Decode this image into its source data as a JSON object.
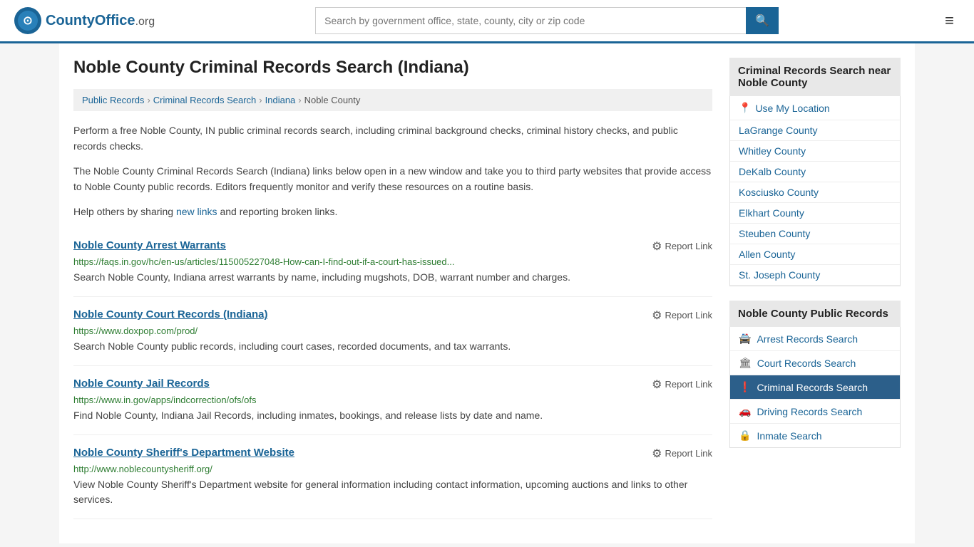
{
  "header": {
    "logo_text": "CountyOffice",
    "logo_ext": ".org",
    "search_placeholder": "Search by government office, state, county, city or zip code",
    "search_value": ""
  },
  "page": {
    "title": "Noble County Criminal Records Search (Indiana)",
    "breadcrumbs": [
      {
        "label": "Public Records",
        "href": "#"
      },
      {
        "label": "Criminal Records Search",
        "href": "#"
      },
      {
        "label": "Indiana",
        "href": "#"
      },
      {
        "label": "Noble County",
        "href": "#"
      }
    ],
    "description1": "Perform a free Noble County, IN public criminal records search, including criminal background checks, criminal history checks, and public records checks.",
    "description2": "The Noble County Criminal Records Search (Indiana) links below open in a new window and take you to third party websites that provide access to Noble County public records. Editors frequently monitor and verify these resources on a routine basis.",
    "description3_prefix": "Help others by sharing ",
    "new_links_label": "new links",
    "description3_suffix": " and reporting broken links.",
    "records": [
      {
        "title": "Noble County Arrest Warrants",
        "url": "https://faqs.in.gov/hc/en-us/articles/115005227048-How-can-I-find-out-if-a-court-has-issued...",
        "description": "Search Noble County, Indiana arrest warrants by name, including mugshots, DOB, warrant number and charges.",
        "report_label": "Report Link"
      },
      {
        "title": "Noble County Court Records (Indiana)",
        "url": "https://www.doxpop.com/prod/",
        "description": "Search Noble County public records, including court cases, recorded documents, and tax warrants.",
        "report_label": "Report Link"
      },
      {
        "title": "Noble County Jail Records",
        "url": "https://www.in.gov/apps/indcorrection/ofs/ofs",
        "description": "Find Noble County, Indiana Jail Records, including inmates, bookings, and release lists by date and name.",
        "report_label": "Report Link"
      },
      {
        "title": "Noble County Sheriff's Department Website",
        "url": "http://www.noblecountysheriff.org/",
        "description": "View Noble County Sheriff's Department website for general information including contact information, upcoming auctions and links to other services.",
        "report_label": "Report Link"
      }
    ]
  },
  "sidebar": {
    "nearby_title": "Criminal Records Search near Noble County",
    "use_location_label": "Use My Location",
    "nearby_counties": [
      "LaGrange County",
      "Whitley County",
      "DeKalb County",
      "Kosciusko County",
      "Elkhart County",
      "Steuben County",
      "Allen County",
      "St. Joseph County"
    ],
    "public_records_title": "Noble County Public Records",
    "public_records_items": [
      {
        "label": "Arrest Records Search",
        "icon": "🚔",
        "active": false
      },
      {
        "label": "Court Records Search",
        "icon": "🏛",
        "active": false
      },
      {
        "label": "Criminal Records Search",
        "icon": "❗",
        "active": true
      },
      {
        "label": "Driving Records Search",
        "icon": "🚗",
        "active": false
      },
      {
        "label": "Inmate Search",
        "icon": "🔒",
        "active": false
      }
    ]
  }
}
